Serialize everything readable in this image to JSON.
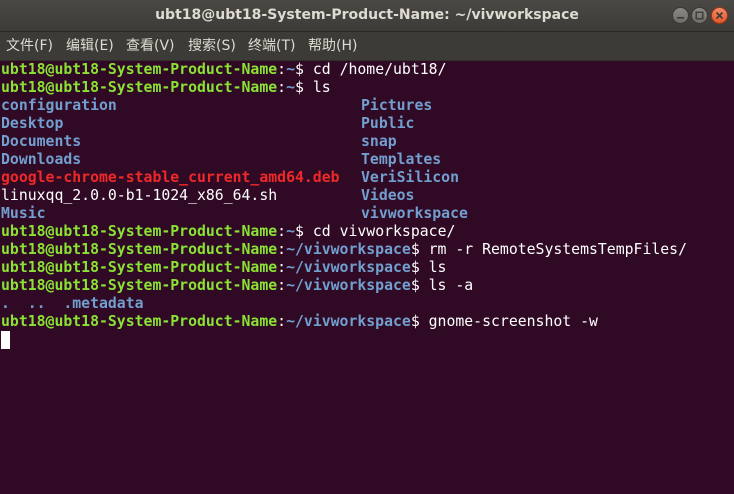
{
  "window": {
    "title": "ubt18@ubt18-System-Product-Name: ~/vivworkspace"
  },
  "menu": {
    "file": "文件(F)",
    "edit": "编辑(E)",
    "view": "查看(V)",
    "search": "搜索(S)",
    "terminal": "终端(T)",
    "help": "帮助(H)"
  },
  "terminal": {
    "prompt_user": "ubt18@ubt18-System-Product-Name",
    "lines": [
      {
        "path": "~",
        "cmd": " cd /home/ubt18/"
      },
      {
        "path": "~",
        "cmd": " ls"
      },
      {
        "path": "~",
        "cmd": " cd vivworkspace/"
      },
      {
        "path": "~/vivworkspace",
        "cmd": " rm -r RemoteSystemsTempFiles/"
      },
      {
        "path": "~/vivworkspace",
        "cmd": " ls"
      },
      {
        "path": "~/vivworkspace",
        "cmd": " ls -a"
      },
      {
        "path": "~/vivworkspace",
        "cmd": " gnome-screenshot -w"
      }
    ],
    "ls_col1": [
      "configuration",
      "Desktop",
      "Documents",
      "Downloads",
      "google-chrome-stable_current_amd64.deb",
      "linuxqq_2.0.0-b1-1024_x86_64.sh",
      "Music"
    ],
    "ls_col2": [
      "Pictures",
      "Public",
      "snap",
      "Templates",
      "VeriSilicon",
      "Videos",
      "vivworkspace"
    ],
    "ls_a_output": {
      "dots": ".  ..  ",
      "metadata": ".metadata"
    }
  },
  "colors": {
    "background": "#300a24",
    "user": "#8ae234",
    "path": "#729fcf",
    "directory": "#729fcf",
    "archive": "#ef2929",
    "text": "#ffffff"
  }
}
